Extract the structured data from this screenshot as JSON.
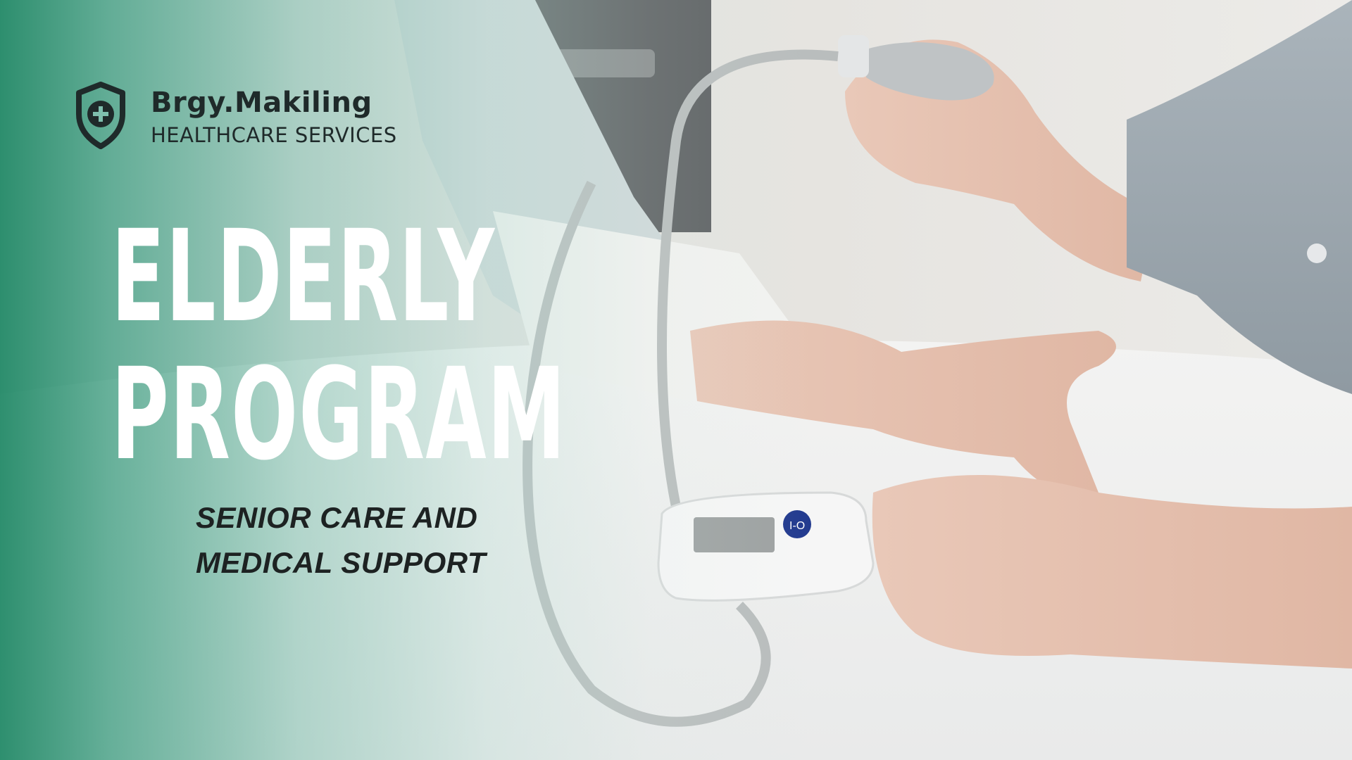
{
  "brand": {
    "name": "Brgy.Makiling",
    "tagline": "HEALTHCARE SERVICES",
    "icon": "shield-medical-icon"
  },
  "headline": {
    "line1": "ELDERLY",
    "line2": "PROGRAM"
  },
  "subtitle": {
    "line1": "SENIOR CARE AND",
    "line2": "MEDICAL SUPPORT"
  },
  "colors": {
    "brand_green": "#248a68",
    "headline": "#ffffff",
    "dark_text": "#1f2a2a"
  }
}
